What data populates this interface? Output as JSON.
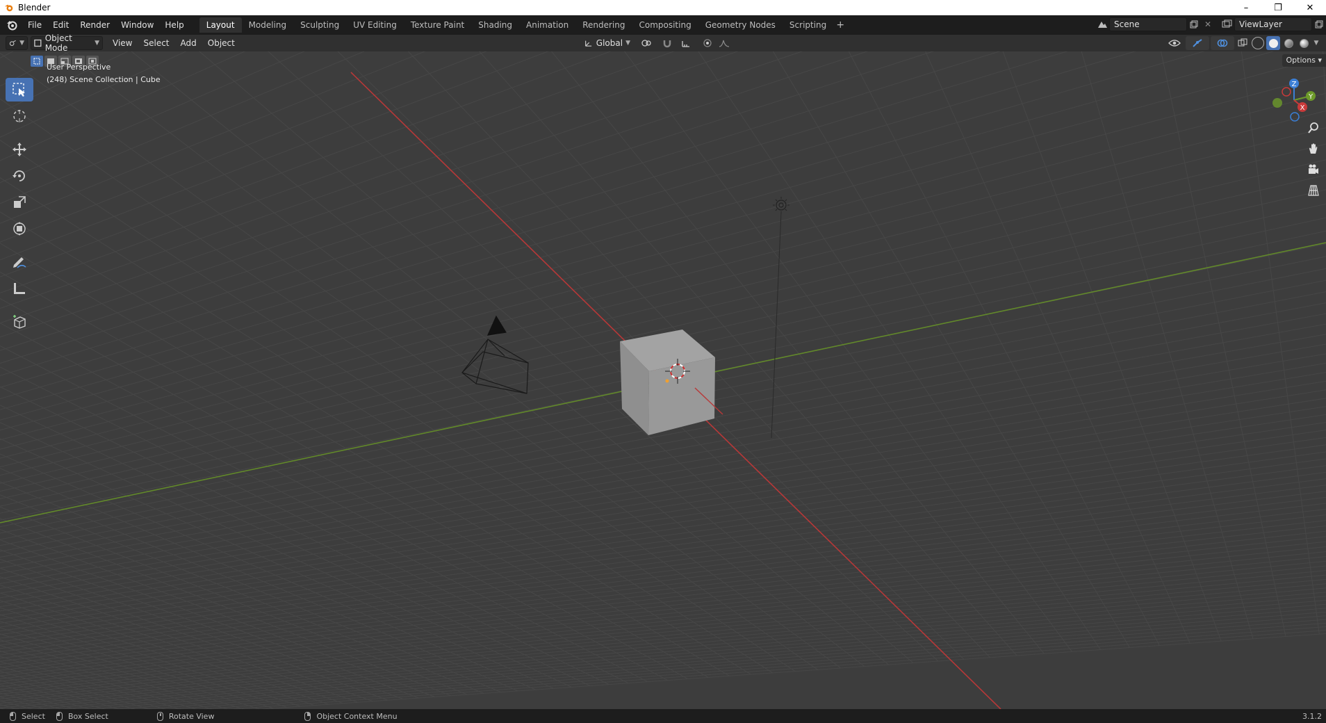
{
  "window": {
    "title": "Blender",
    "icon": "blender-logo-icon",
    "buttons": [
      "minimize-icon",
      "restore-icon",
      "close-icon"
    ],
    "minimize_glyph": "–",
    "restore_glyph": "❐",
    "close_glyph": "✕"
  },
  "menubar": {
    "items": [
      "File",
      "Edit",
      "Render",
      "Window",
      "Help"
    ]
  },
  "workspaces": {
    "tabs": [
      "Layout",
      "Modeling",
      "Sculpting",
      "UV Editing",
      "Texture Paint",
      "Shading",
      "Animation",
      "Rendering",
      "Compositing",
      "Geometry Nodes",
      "Scripting"
    ],
    "active": "Layout",
    "add_glyph": "+"
  },
  "scene": {
    "scene_name": "Scene",
    "view_layer": "ViewLayer"
  },
  "viewport_header": {
    "mode": "Object Mode",
    "menus": [
      "View",
      "Select",
      "Add",
      "Object"
    ],
    "transform_orientation": "Global"
  },
  "viewport": {
    "perspective_label": "User Perspective",
    "collection_label": "(248) Scene Collection | Cube",
    "options_label": "Options",
    "gizmo_axes": {
      "z": "Z",
      "y": "Y",
      "x": "X"
    },
    "colors": {
      "x_axis": "#c83a3a",
      "y_axis": "#6d9a2a",
      "background": "#3d3d3d",
      "grid": "#474747",
      "accent": "#4772b3"
    }
  },
  "toolbar": {
    "tools": [
      "select-box-icon",
      "cursor-icon",
      "move-icon",
      "rotate-icon",
      "scale-icon",
      "transform-icon",
      "annotate-icon",
      "measure-icon",
      "add-cube-icon"
    ],
    "active": "select-box-icon"
  },
  "statusbar": {
    "select": "Select",
    "box_select": "Box Select",
    "rotate_view": "Rotate View",
    "context_menu": "Object Context Menu",
    "version": "3.1.2"
  }
}
